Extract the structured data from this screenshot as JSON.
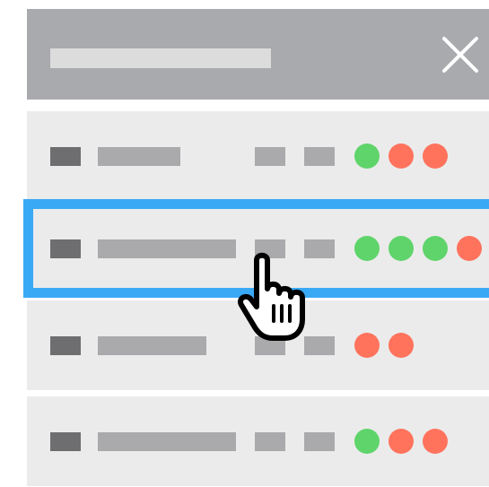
{
  "header": {
    "title": "",
    "close_icon": "close-icon"
  },
  "colors": {
    "header_bg": "#a9aaae",
    "row_bg": "#ebebeb",
    "selection": "#3aa9f5",
    "status_ok": "#5fd46a",
    "status_error": "#ff735d"
  },
  "rows": [
    {
      "selected": false,
      "status": [
        "ok",
        "error",
        "error"
      ]
    },
    {
      "selected": true,
      "status": [
        "ok",
        "ok",
        "ok",
        "error"
      ]
    },
    {
      "selected": false,
      "status": [
        "error",
        "error"
      ]
    },
    {
      "selected": false,
      "status": [
        "ok",
        "error",
        "error"
      ]
    }
  ],
  "cursor": {
    "icon": "hand-pointer-icon"
  }
}
